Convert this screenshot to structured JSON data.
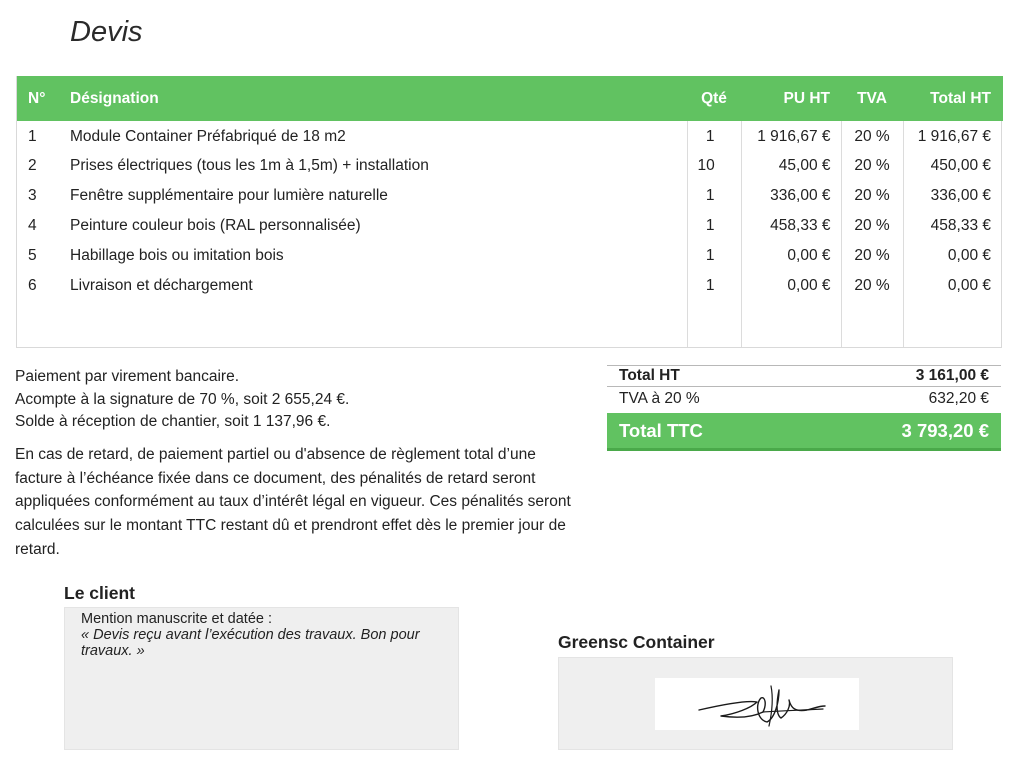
{
  "document": {
    "title": "Devis"
  },
  "items_table": {
    "headers": {
      "num": "N°",
      "designation": "Désignation",
      "qte": "Qté",
      "pu_ht": "PU HT",
      "tva": "TVA",
      "total_ht": "Total HT"
    },
    "rows": [
      {
        "num": "1",
        "designation": "Module Container Préfabriqué de 18 m2",
        "qte": "1",
        "pu_ht": "1 916,67 €",
        "tva": "20 %",
        "total_ht": "1 916,67 €"
      },
      {
        "num": "2",
        "designation": "Prises électriques (tous les 1m à 1,5m) + installation",
        "qte": "10",
        "pu_ht": "45,00 €",
        "tva": "20 %",
        "total_ht": "450,00 €"
      },
      {
        "num": "3",
        "designation": "Fenêtre supplémentaire pour lumière naturelle",
        "qte": "1",
        "pu_ht": "336,00 €",
        "tva": "20 %",
        "total_ht": "336,00 €"
      },
      {
        "num": "4",
        "designation": "Peinture couleur bois (RAL personnalisée)",
        "qte": "1",
        "pu_ht": "458,33 €",
        "tva": "20 %",
        "total_ht": "458,33 €"
      },
      {
        "num": "5",
        "designation": "Habillage bois ou imitation bois",
        "qte": "1",
        "pu_ht": "0,00 €",
        "tva": "20 %",
        "total_ht": "0,00 €"
      },
      {
        "num": "6",
        "designation": "Livraison et déchargement",
        "qte": "1",
        "pu_ht": "0,00 €",
        "tva": "20 %",
        "total_ht": "0,00 €"
      }
    ]
  },
  "payment": {
    "line1": "Paiement par virement bancaire.",
    "line2": "Acompte à la signature de 70 %, soit 2 655,24 €.",
    "line3": "Solde à réception de chantier, soit 1 137,96 €.",
    "penalty": " En cas de retard, de paiement partiel ou d'absence de règlement total d’une facture à l’échéance fixée dans ce document, des pénalités de retard seront appliquées conformément au taux d’intérêt légal en vigueur. Ces pénalités seront calculées sur le montant TTC restant dû et prendront effet dès le premier jour de retard."
  },
  "totals": {
    "ht_label": "Total HT",
    "ht_value": "3 161,00 €",
    "tva_label": "TVA à 20 %",
    "tva_value": "632,20 €",
    "ttc_label": "Total TTC",
    "ttc_value": "3 793,20 €"
  },
  "client": {
    "title": "Le client",
    "mention": "Mention manuscrite et datée :",
    "quote": "« Devis reçu avant l’exécution des travaux. Bon pour travaux. »"
  },
  "company": {
    "title": "Greensc Container"
  },
  "colors": {
    "accent_green": "#61c261",
    "box_gray": "#efefef"
  }
}
